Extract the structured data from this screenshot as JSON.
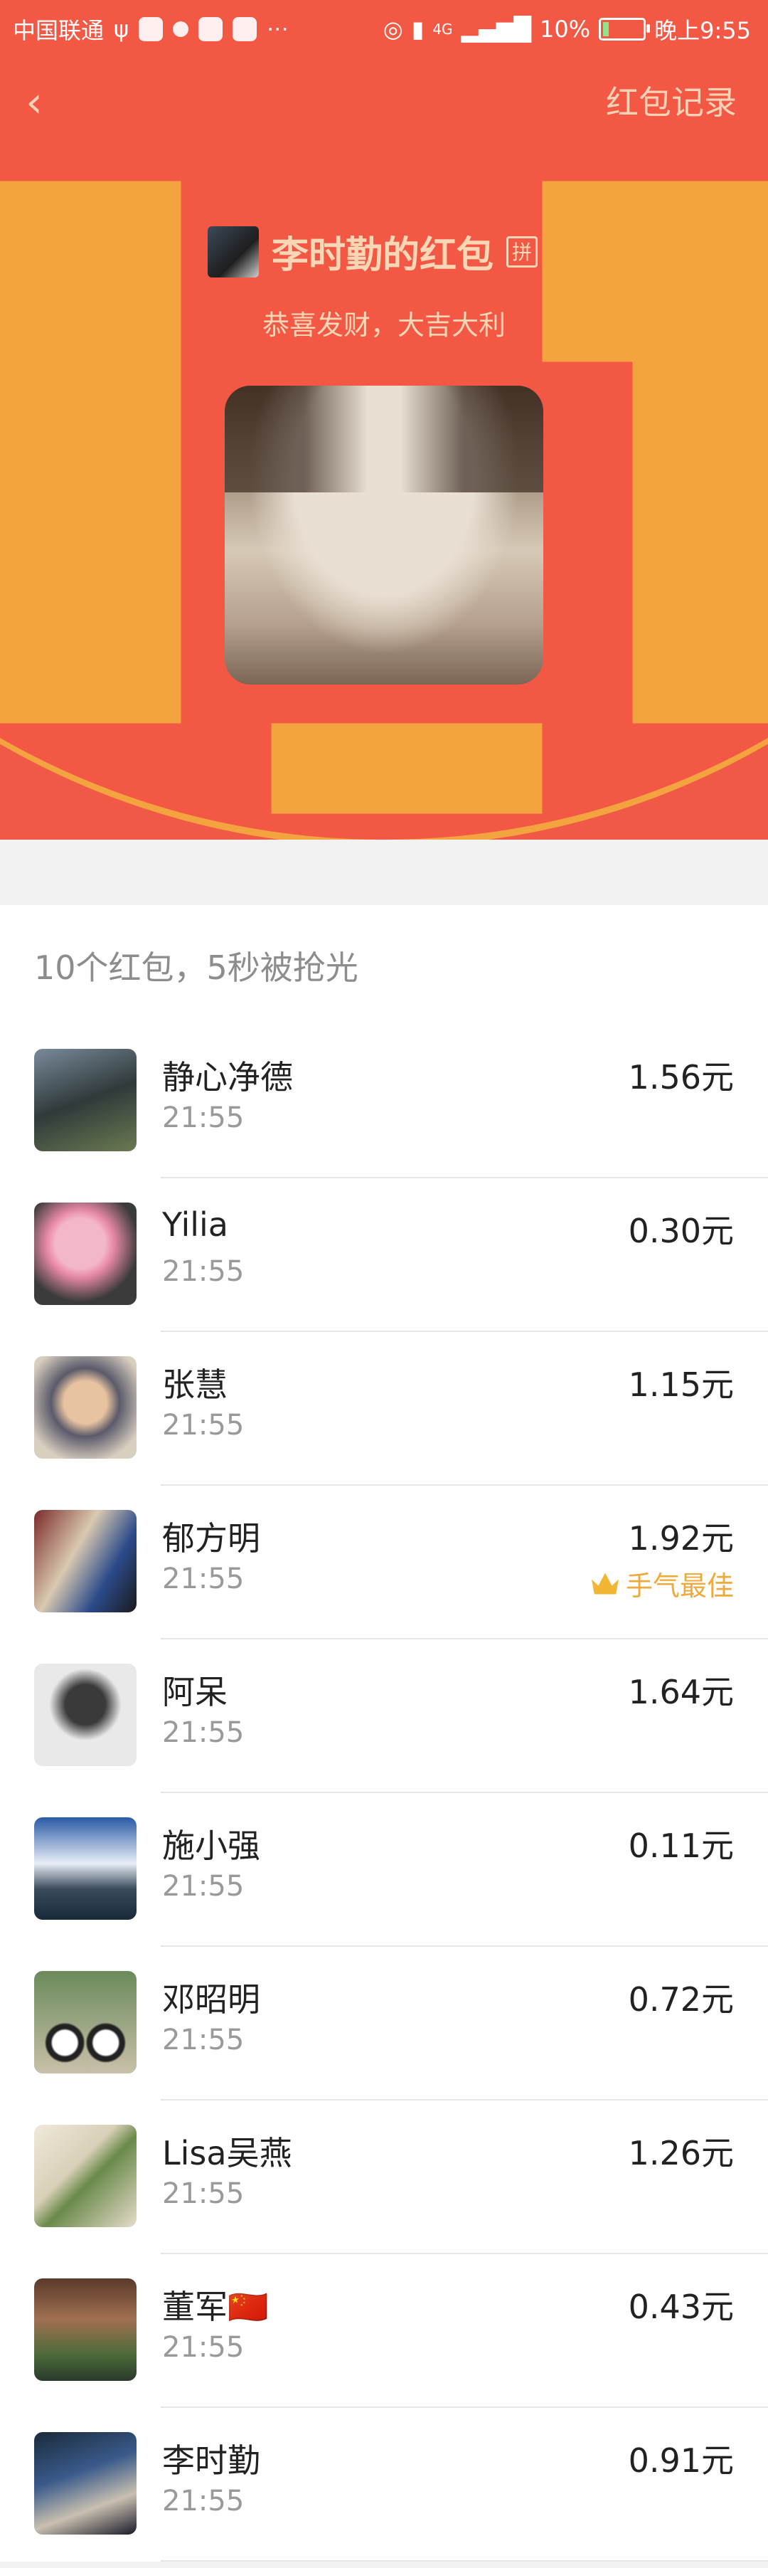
{
  "status_bar": {
    "carrier": "中国联通",
    "usb": "ψ",
    "more": "···",
    "signal_text": "4G",
    "battery": "10%",
    "time": "晚上9:55"
  },
  "nav": {
    "back_icon": "chevron-left-icon",
    "records_label": "红包记录"
  },
  "sender": {
    "name": "李时勤的红包",
    "pin_label": "拼",
    "wish": "恭喜发财，大吉大利"
  },
  "summary": "10个红包，5秒被抢光",
  "best_label": "手气最佳",
  "items": [
    {
      "name": "静心净德",
      "time": "21:55",
      "amount": "1.56元"
    },
    {
      "name": "Yilia",
      "time": "21:55",
      "amount": "0.30元"
    },
    {
      "name": "张慧",
      "time": "21:55",
      "amount": "1.15元"
    },
    {
      "name": "郁方明",
      "time": "21:55",
      "amount": "1.92元",
      "best": true
    },
    {
      "name": "阿呆",
      "time": "21:55",
      "amount": "1.64元"
    },
    {
      "name": "施小强",
      "time": "21:55",
      "amount": "0.11元"
    },
    {
      "name": "邓昭明",
      "time": "21:55",
      "amount": "0.72元"
    },
    {
      "name": "Lisa吴燕",
      "time": "21:55",
      "amount": "1.26元"
    },
    {
      "name": "董军🇨🇳",
      "time": "21:55",
      "amount": "0.43元"
    },
    {
      "name": "李时勤",
      "time": "21:55",
      "amount": "0.91元"
    }
  ],
  "colors": {
    "header": "#f35845",
    "gold_text": "#f7d7b6",
    "best": "#efaa3b"
  }
}
